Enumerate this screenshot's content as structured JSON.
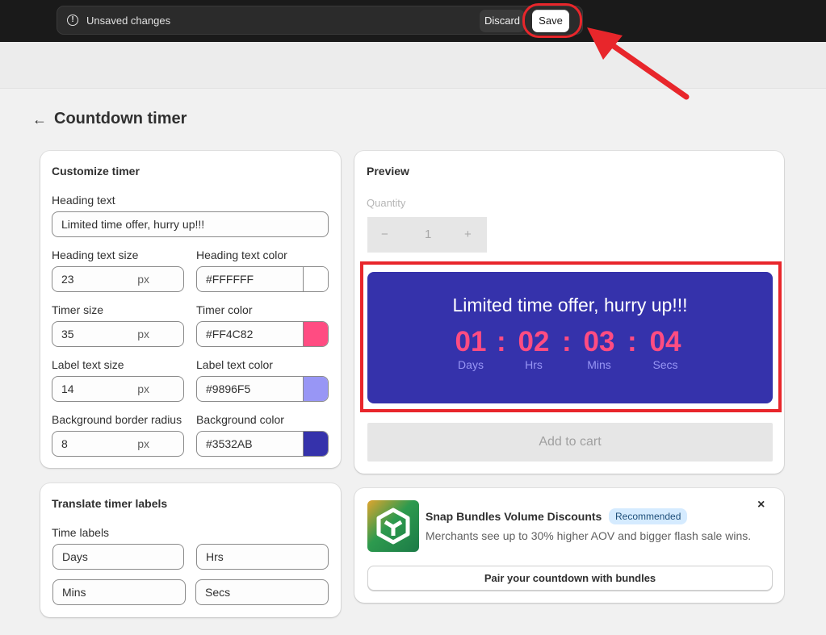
{
  "savebar": {
    "message": "Unsaved changes",
    "discard_label": "Discard",
    "save_label": "Save"
  },
  "page": {
    "title": "Countdown timer"
  },
  "customize": {
    "title": "Customize timer",
    "heading_text_label": "Heading text",
    "heading_text_value": "Limited time offer, hurry up!!!",
    "heading_size_label": "Heading text size",
    "heading_size_value": "23",
    "heading_color_label": "Heading text color",
    "heading_color_value": "#FFFFFF",
    "timer_size_label": "Timer size",
    "timer_size_value": "35",
    "timer_color_label": "Timer color",
    "timer_color_value": "#FF4C82",
    "label_size_label": "Label text size",
    "label_size_value": "14",
    "label_color_label": "Label text color",
    "label_color_value": "#9896F5",
    "radius_label": "Background border radius",
    "radius_value": "8",
    "bg_color_label": "Background color",
    "bg_color_value": "#3532AB",
    "unit_suffix": "px"
  },
  "translate": {
    "title": "Translate timer labels",
    "time_labels_label": "Time labels",
    "days": "Days",
    "hrs": "Hrs",
    "mins": "Mins",
    "secs": "Secs"
  },
  "preview": {
    "title": "Preview",
    "quantity_label": "Quantity",
    "qty_minus": "−",
    "qty_value": "1",
    "qty_plus": "+",
    "timer_heading": "Limited time offer, hurry up!!!",
    "days_num": "01",
    "hrs_num": "02",
    "mins_num": "03",
    "secs_num": "04",
    "separator": ":",
    "days_label": "Days",
    "hrs_label": "Hrs",
    "mins_label": "Mins",
    "secs_label": "Secs",
    "add_to_cart": "Add to cart"
  },
  "promo": {
    "app_name": "Snap Bundles Volume Discounts",
    "badge": "Recommended",
    "description": "Merchants see up to 30% higher AOV and bigger flash sale wins.",
    "close": "×",
    "cta": "Pair your countdown with bundles",
    "icon": "snap-bundles-logo-icon"
  },
  "colors": {
    "heading": "#FFFFFF",
    "timer": "#FF4C82",
    "label": "#9896F5",
    "background": "#3532AB",
    "annotation": "#E8262B"
  }
}
